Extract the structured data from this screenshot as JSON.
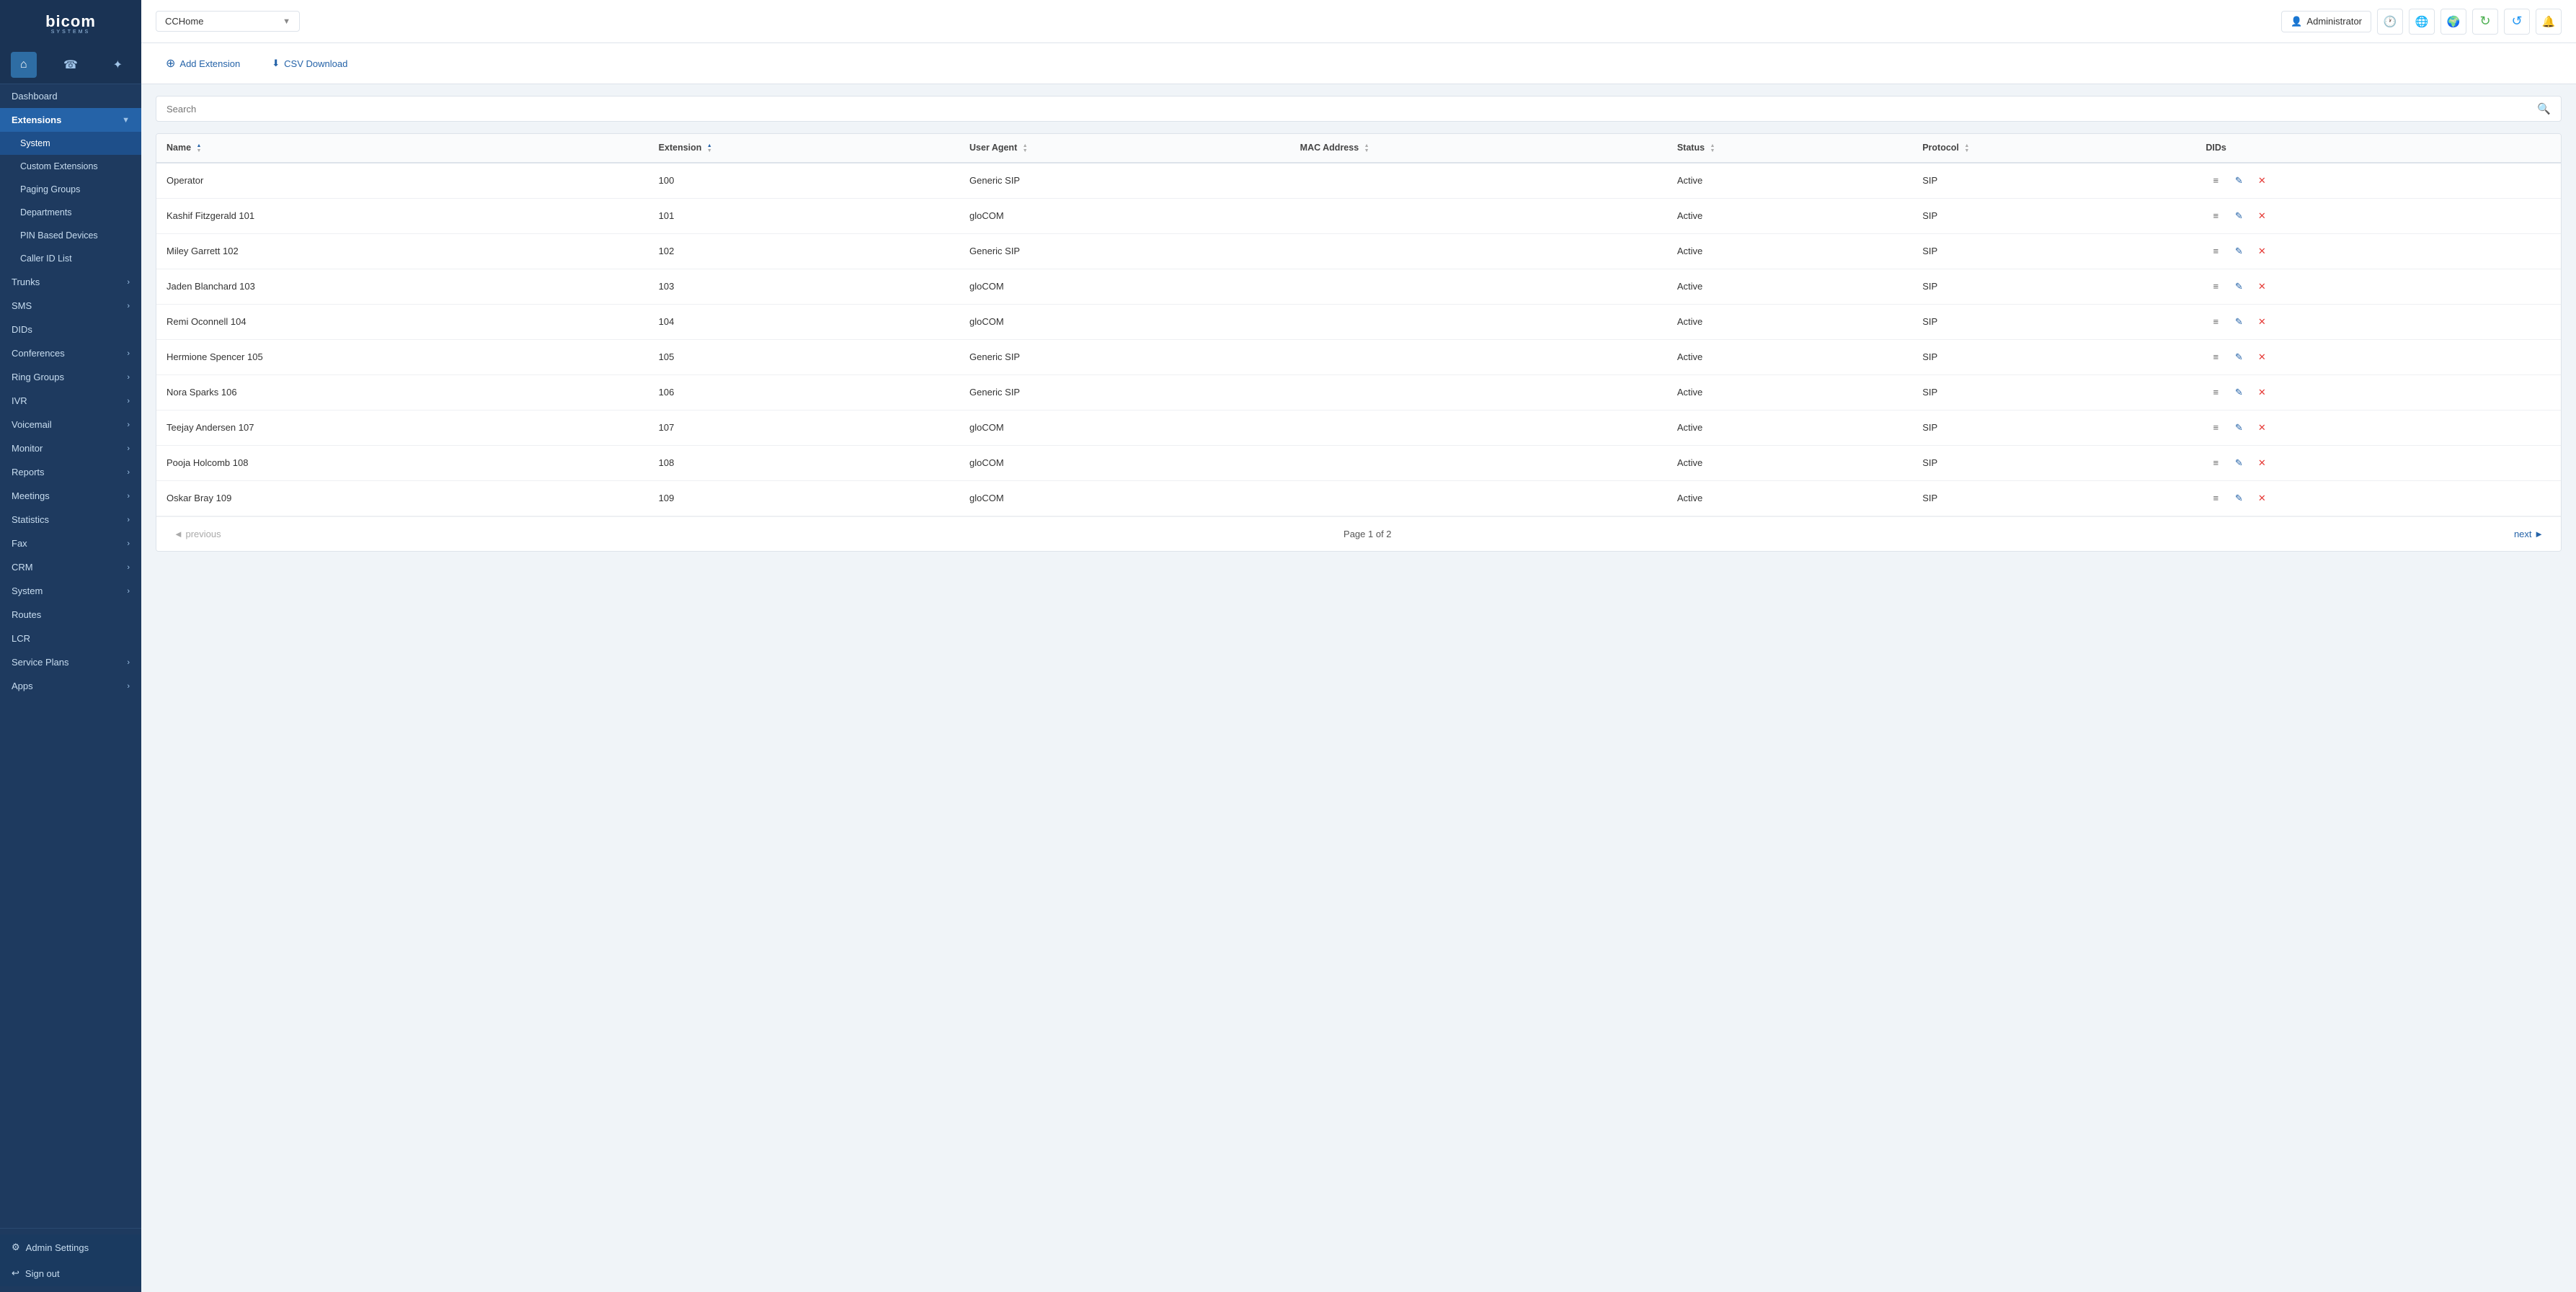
{
  "sidebar": {
    "logo": {
      "main": "bicom",
      "sub": "SYSTEMS"
    },
    "icons": [
      {
        "name": "home-icon",
        "label": "Home",
        "symbol": "⌂",
        "active": true
      },
      {
        "name": "phone-icon",
        "label": "Phone",
        "symbol": "☎",
        "active": false
      },
      {
        "name": "network-icon",
        "label": "Network",
        "symbol": "✦",
        "active": false
      }
    ],
    "nav": [
      {
        "id": "dashboard",
        "label": "Dashboard",
        "level": 0,
        "active": false,
        "hasArrow": false
      },
      {
        "id": "extensions",
        "label": "Extensions",
        "level": 0,
        "active": true,
        "hasArrow": true
      },
      {
        "id": "system",
        "label": "System",
        "level": 1,
        "active": true,
        "hasArrow": false
      },
      {
        "id": "custom-extensions",
        "label": "Custom Extensions",
        "level": 1,
        "active": false,
        "hasArrow": false
      },
      {
        "id": "paging-groups",
        "label": "Paging Groups",
        "level": 1,
        "active": false,
        "hasArrow": false
      },
      {
        "id": "departments",
        "label": "Departments",
        "level": 1,
        "active": false,
        "hasArrow": false
      },
      {
        "id": "pin-based-devices",
        "label": "PIN Based Devices",
        "level": 1,
        "active": false,
        "hasArrow": false
      },
      {
        "id": "caller-id-list",
        "label": "Caller ID List",
        "level": 1,
        "active": false,
        "hasArrow": false
      },
      {
        "id": "trunks",
        "label": "Trunks",
        "level": 0,
        "active": false,
        "hasArrow": true
      },
      {
        "id": "sms",
        "label": "SMS",
        "level": 0,
        "active": false,
        "hasArrow": true
      },
      {
        "id": "dids",
        "label": "DIDs",
        "level": 0,
        "active": false,
        "hasArrow": false
      },
      {
        "id": "conferences",
        "label": "Conferences",
        "level": 0,
        "active": false,
        "hasArrow": true
      },
      {
        "id": "ring-groups",
        "label": "Ring Groups",
        "level": 0,
        "active": false,
        "hasArrow": true
      },
      {
        "id": "ivr",
        "label": "IVR",
        "level": 0,
        "active": false,
        "hasArrow": true
      },
      {
        "id": "voicemail",
        "label": "Voicemail",
        "level": 0,
        "active": false,
        "hasArrow": true
      },
      {
        "id": "monitor",
        "label": "Monitor",
        "level": 0,
        "active": false,
        "hasArrow": true
      },
      {
        "id": "reports",
        "label": "Reports",
        "level": 0,
        "active": false,
        "hasArrow": true
      },
      {
        "id": "meetings",
        "label": "Meetings",
        "level": 0,
        "active": false,
        "hasArrow": true
      },
      {
        "id": "statistics",
        "label": "Statistics",
        "level": 0,
        "active": false,
        "hasArrow": true
      },
      {
        "id": "fax",
        "label": "Fax",
        "level": 0,
        "active": false,
        "hasArrow": true
      },
      {
        "id": "crm",
        "label": "CRM",
        "level": 0,
        "active": false,
        "hasArrow": true
      },
      {
        "id": "system2",
        "label": "System",
        "level": 0,
        "active": false,
        "hasArrow": true
      },
      {
        "id": "routes",
        "label": "Routes",
        "level": 0,
        "active": false,
        "hasArrow": false
      },
      {
        "id": "lcr",
        "label": "LCR",
        "level": 0,
        "active": false,
        "hasArrow": false
      },
      {
        "id": "service-plans",
        "label": "Service Plans",
        "level": 0,
        "active": false,
        "hasArrow": true
      },
      {
        "id": "apps",
        "label": "Apps",
        "level": 0,
        "active": false,
        "hasArrow": true
      }
    ],
    "bottom_buttons": [
      {
        "id": "admin-settings",
        "label": "Admin Settings",
        "icon": "⚙"
      },
      {
        "id": "sign-out",
        "label": "Sign out",
        "icon": "↩"
      }
    ]
  },
  "header": {
    "domain": "CCHome",
    "domain_arrow": "▼",
    "admin_icon": "👤",
    "admin_label": "Administrator",
    "buttons": [
      {
        "name": "clock-icon",
        "symbol": "🕐",
        "label": "Time"
      },
      {
        "name": "globe-icon",
        "symbol": "🌐",
        "label": "Globe"
      },
      {
        "name": "world-icon",
        "symbol": "🌍",
        "label": "World"
      },
      {
        "name": "refresh-green-icon",
        "symbol": "↻",
        "label": "Refresh",
        "color": "green"
      },
      {
        "name": "refresh-blue-icon",
        "symbol": "↺",
        "label": "Refresh2",
        "color": "blue"
      },
      {
        "name": "bell-icon",
        "symbol": "🔔",
        "label": "Notifications"
      }
    ]
  },
  "toolbar": {
    "add_label": "Add Extension",
    "csv_label": "CSV Download"
  },
  "search": {
    "placeholder": "Search"
  },
  "table": {
    "columns": [
      {
        "id": "name",
        "label": "Name",
        "sortable": true,
        "sort_dir": "asc"
      },
      {
        "id": "extension",
        "label": "Extension",
        "sortable": true,
        "sort_dir": "up"
      },
      {
        "id": "user_agent",
        "label": "User Agent",
        "sortable": true
      },
      {
        "id": "mac_address",
        "label": "MAC Address",
        "sortable": true
      },
      {
        "id": "status",
        "label": "Status",
        "sortable": true
      },
      {
        "id": "protocol",
        "label": "Protocol",
        "sortable": true
      },
      {
        "id": "dids",
        "label": "DIDs",
        "sortable": false
      }
    ],
    "rows": [
      {
        "name": "Operator",
        "extension": "100",
        "user_agent": "Generic SIP",
        "mac_address": "",
        "status": "Active",
        "protocol": "SIP"
      },
      {
        "name": "Kashif Fitzgerald 101",
        "extension": "101",
        "user_agent": "gloCOM",
        "mac_address": "",
        "status": "Active",
        "protocol": "SIP"
      },
      {
        "name": "Miley Garrett 102",
        "extension": "102",
        "user_agent": "Generic SIP",
        "mac_address": "",
        "status": "Active",
        "protocol": "SIP"
      },
      {
        "name": "Jaden Blanchard 103",
        "extension": "103",
        "user_agent": "gloCOM",
        "mac_address": "",
        "status": "Active",
        "protocol": "SIP"
      },
      {
        "name": "Remi Oconnell 104",
        "extension": "104",
        "user_agent": "gloCOM",
        "mac_address": "",
        "status": "Active",
        "protocol": "SIP"
      },
      {
        "name": "Hermione Spencer 105",
        "extension": "105",
        "user_agent": "Generic SIP",
        "mac_address": "",
        "status": "Active",
        "protocol": "SIP"
      },
      {
        "name": "Nora Sparks 106",
        "extension": "106",
        "user_agent": "Generic SIP",
        "mac_address": "",
        "status": "Active",
        "protocol": "SIP"
      },
      {
        "name": "Teejay Andersen 107",
        "extension": "107",
        "user_agent": "gloCOM",
        "mac_address": "",
        "status": "Active",
        "protocol": "SIP"
      },
      {
        "name": "Pooja Holcomb 108",
        "extension": "108",
        "user_agent": "gloCOM",
        "mac_address": "",
        "status": "Active",
        "protocol": "SIP"
      },
      {
        "name": "Oskar Bray 109",
        "extension": "109",
        "user_agent": "gloCOM",
        "mac_address": "",
        "status": "Active",
        "protocol": "SIP"
      }
    ]
  },
  "pagination": {
    "page_label": "Page 1 of 2",
    "prev_label": "◄ previous",
    "next_label": "next ►",
    "prev_disabled": true,
    "next_disabled": false
  }
}
